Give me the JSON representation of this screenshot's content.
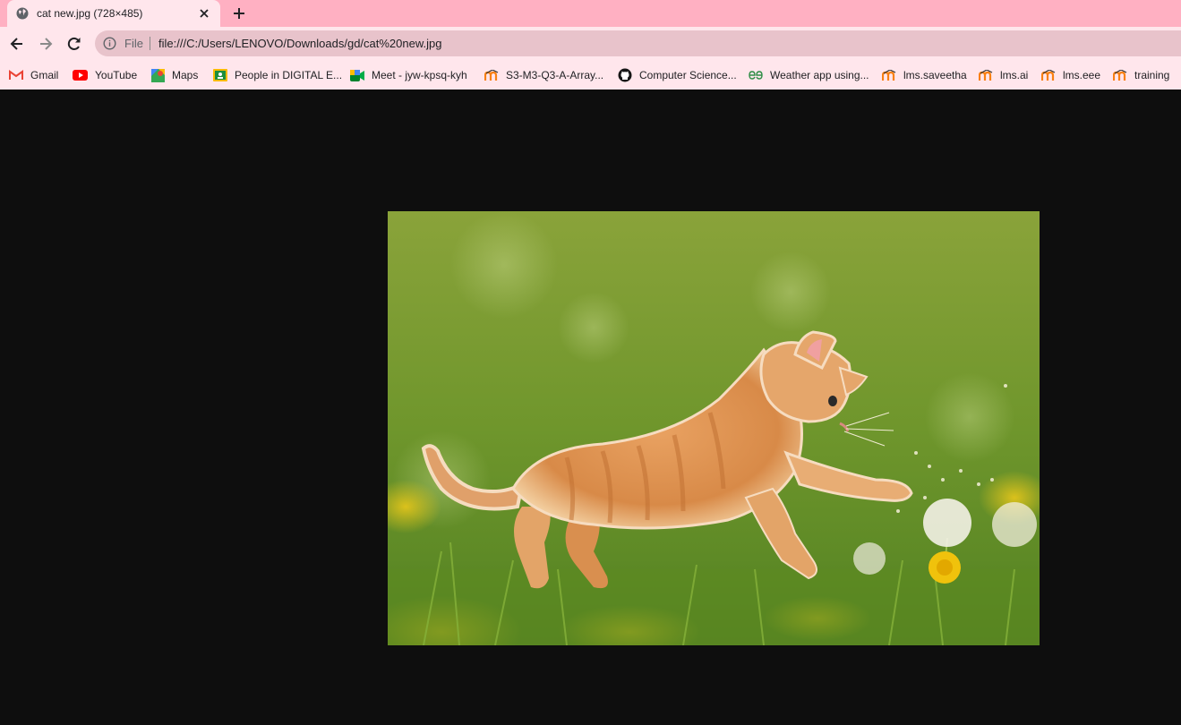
{
  "tab": {
    "title": "cat new.jpg (728×485)",
    "favicon": "globe-icon"
  },
  "toolbar": {
    "back": "back-arrow-icon",
    "forward": "forward-arrow-icon",
    "reload": "reload-icon",
    "scheme_label": "File",
    "url": "file:///C:/Users/LENOVO/Downloads/gd/cat%20new.jpg"
  },
  "bookmarks": [
    {
      "label": "Gmail",
      "icon": "gmail-icon"
    },
    {
      "label": "YouTube",
      "icon": "youtube-icon"
    },
    {
      "label": "Maps",
      "icon": "maps-icon"
    },
    {
      "label": "People in DIGITAL E...",
      "icon": "classroom-icon"
    },
    {
      "label": "Meet - jyw-kpsq-kyh",
      "icon": "meet-icon"
    },
    {
      "label": "S3-M3-Q3-A-Array...",
      "icon": "moodle-icon"
    },
    {
      "label": "Computer Science...",
      "icon": "github-icon"
    },
    {
      "label": "Weather app using...",
      "icon": "geeksforgeeks-icon"
    },
    {
      "label": "lms.saveetha",
      "icon": "moodle-icon"
    },
    {
      "label": "lms.ai",
      "icon": "moodle-icon"
    },
    {
      "label": "lms.eee",
      "icon": "moodle-icon"
    },
    {
      "label": "training",
      "icon": "moodle-icon"
    }
  ],
  "image": {
    "subject": "orange kitten in grass chasing dandelion",
    "background": "#0e0e0e"
  },
  "colors": {
    "tabstrip": "#ffb0c2",
    "toolbar": "#ffe6ec",
    "omnibox": "#e8c3cb"
  }
}
